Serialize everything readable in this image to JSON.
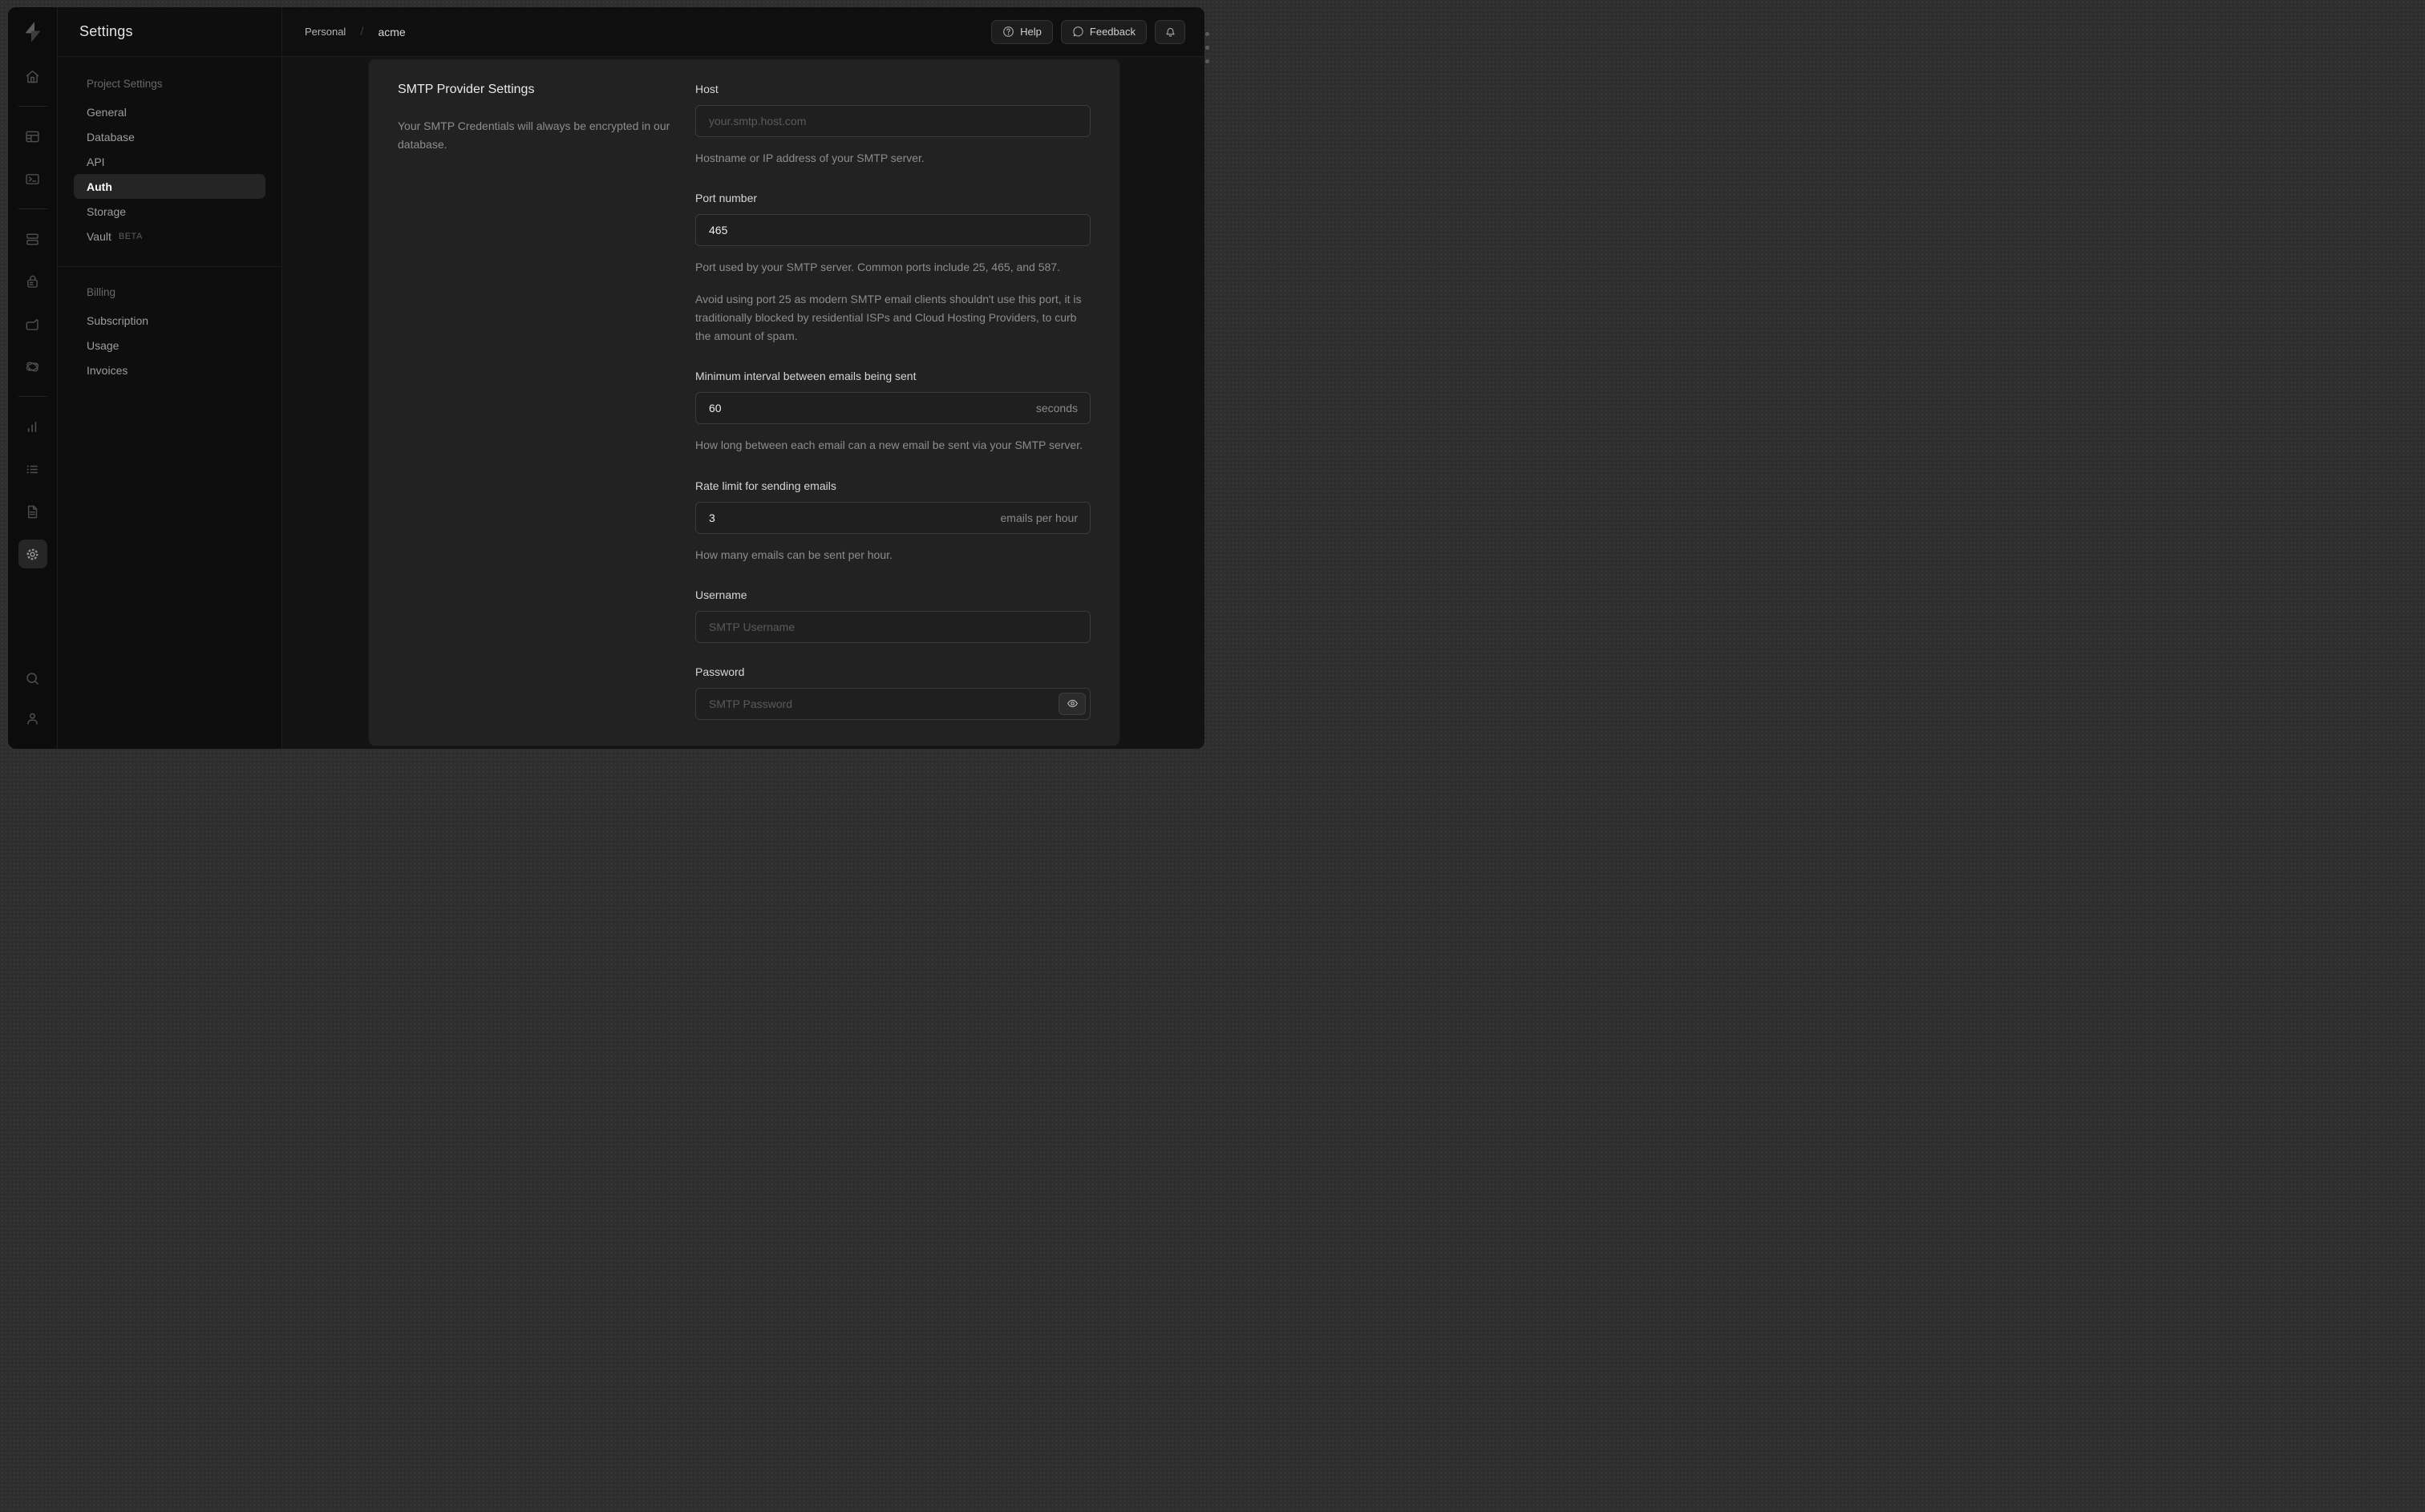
{
  "colors": {
    "backdrop": "#2e2e2e",
    "window_bg": "#0e0e0e",
    "panel_bg": "#222222",
    "border": "#1e1e1e",
    "input_border": "#3b3b3b",
    "text_primary": "#eaeaea",
    "text_muted": "#8d8d8d",
    "placeholder": "#5a5a5a"
  },
  "rail": {
    "logo": "supabase-logo",
    "icons": [
      "home",
      "table-editor",
      "sql-editor",
      "database",
      "authentication",
      "storage",
      "edge-functions",
      "reports",
      "logs",
      "docs",
      "settings",
      "search",
      "user"
    ],
    "active_icon": "settings"
  },
  "sidebar": {
    "title": "Settings",
    "sections": [
      {
        "label": "Project Settings",
        "items": [
          {
            "label": "General"
          },
          {
            "label": "Database"
          },
          {
            "label": "API"
          },
          {
            "label": "Auth",
            "active": true
          },
          {
            "label": "Storage"
          },
          {
            "label": "Vault",
            "badge": "BETA"
          }
        ]
      },
      {
        "label": "Billing",
        "items": [
          {
            "label": "Subscription"
          },
          {
            "label": "Usage"
          },
          {
            "label": "Invoices"
          }
        ]
      }
    ]
  },
  "topbar": {
    "breadcrumb": {
      "org": "Personal",
      "separator": "/",
      "project": "acme"
    },
    "help_label": "Help",
    "feedback_label": "Feedback"
  },
  "form": {
    "section_title": "SMTP Provider Settings",
    "section_description": "Your SMTP Credentials will always be encrypted in our database.",
    "host": {
      "label": "Host",
      "placeholder": "your.smtp.host.com",
      "helper": "Hostname or IP address of your SMTP server."
    },
    "port": {
      "label": "Port number",
      "value": "465",
      "helper1": "Port used by your SMTP server. Common ports include 25, 465, and 587.",
      "helper2": "Avoid using port 25 as modern SMTP email clients shouldn't use this port, it is traditionally blocked by residential ISPs and Cloud Hosting Providers, to curb the amount of spam."
    },
    "interval": {
      "label": "Minimum interval between emails being sent",
      "value": "60",
      "suffix": "seconds",
      "helper": "How long between each email can a new email be sent via your SMTP server."
    },
    "rate": {
      "label": "Rate limit for sending emails",
      "value": "3",
      "suffix": "emails per hour",
      "helper": "How many emails can be sent per hour."
    },
    "username": {
      "label": "Username",
      "placeholder": "SMTP Username"
    },
    "password": {
      "label": "Password",
      "placeholder": "SMTP Password"
    }
  }
}
